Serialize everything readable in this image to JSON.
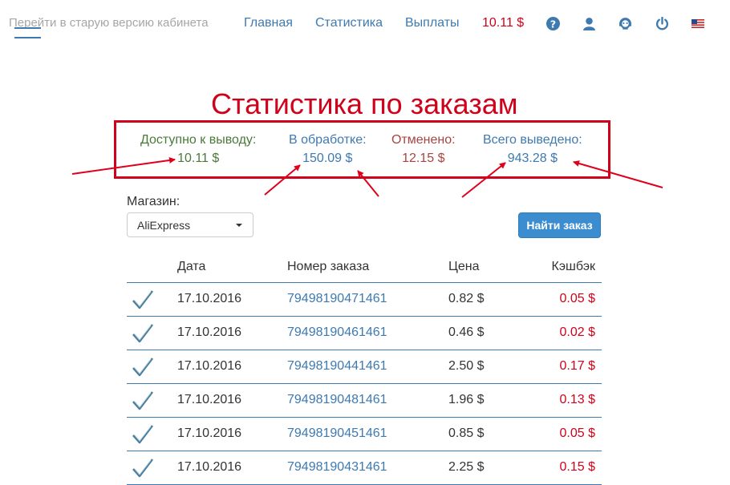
{
  "nav": {
    "old_version": "Перейти в старую версию кабинета",
    "home": "Главная",
    "stats": "Статистика",
    "payouts": "Выплаты",
    "balance": "10.11 $"
  },
  "title": "Статистика по заказам",
  "summary": {
    "available_label": "Доступно к выводу:",
    "available_value": "10.11 $",
    "processing_label": "В обработке:",
    "processing_value": "150.09 $",
    "cancelled_label": "Отменено:",
    "cancelled_value": "12.15 $",
    "withdrawn_label": "Всего выведено:",
    "withdrawn_value": "943.28 $"
  },
  "filter": {
    "shop_label": "Магазин:",
    "shop_value": "AliExpress",
    "find_button": "Найти заказ"
  },
  "table": {
    "headers": {
      "date": "Дата",
      "order": "Номер заказа",
      "price": "Цена",
      "cashback": "Кэшбэк"
    },
    "rows": [
      {
        "date": "17.10.2016",
        "order": "79498190471461",
        "price": "0.82 $",
        "cashback": "0.05 $"
      },
      {
        "date": "17.10.2016",
        "order": "79498190461461",
        "price": "0.46 $",
        "cashback": "0.02 $"
      },
      {
        "date": "17.10.2016",
        "order": "79498190441461",
        "price": "2.50 $",
        "cashback": "0.17 $"
      },
      {
        "date": "17.10.2016",
        "order": "79498190481461",
        "price": "1.96 $",
        "cashback": "0.13 $"
      },
      {
        "date": "17.10.2016",
        "order": "79498190451461",
        "price": "0.85 $",
        "cashback": "0.05 $"
      },
      {
        "date": "17.10.2016",
        "order": "79498190431461",
        "price": "2.25 $",
        "cashback": "0.15 $"
      }
    ]
  },
  "colors": {
    "accent_blue": "#3d7ab0",
    "highlight_red": "#d0021b",
    "available_green": "#4a7a3a",
    "cancelled_brown": "#a94442"
  },
  "icons": [
    "help-icon",
    "user-icon",
    "support-icon",
    "power-icon",
    "us-flag-icon",
    "checkmark-icon"
  ]
}
